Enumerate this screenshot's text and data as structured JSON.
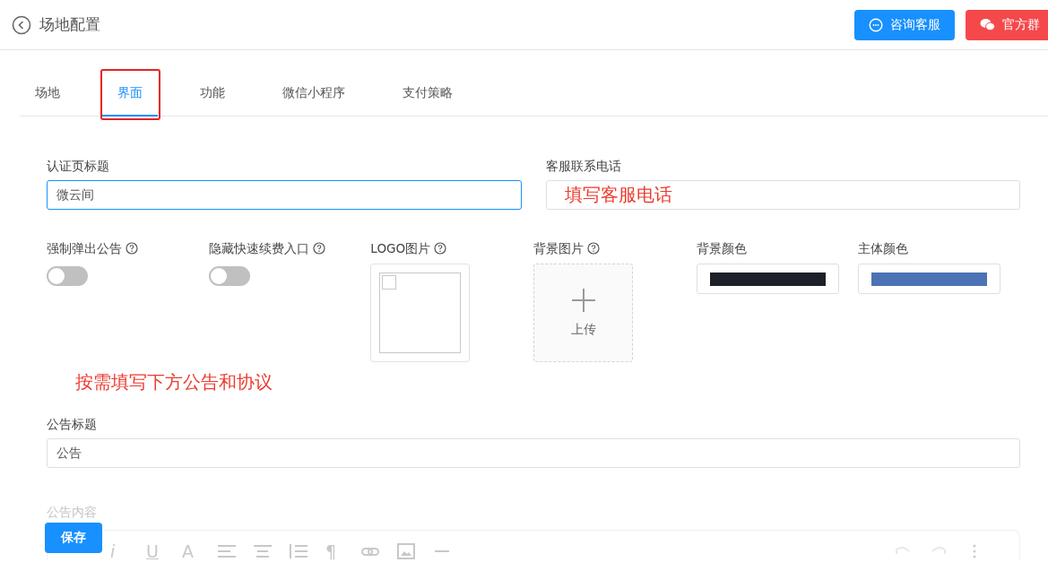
{
  "header": {
    "title": "场地配置",
    "buttons": [
      {
        "label": "咨询客服",
        "kind": "chat"
      },
      {
        "label": "官方群",
        "kind": "wechat"
      }
    ]
  },
  "tabs": [
    {
      "label": "场地",
      "selected": false,
      "highlighted": false
    },
    {
      "label": "界面",
      "selected": true,
      "highlighted": true
    },
    {
      "label": "功能",
      "selected": false,
      "highlighted": false
    },
    {
      "label": "微信小程序",
      "selected": false,
      "highlighted": false
    },
    {
      "label": "支付策略",
      "selected": false,
      "highlighted": false
    }
  ],
  "auth_title": {
    "label": "认证页标题",
    "value": "微云间",
    "focused": true
  },
  "service_phone": {
    "label": "客服联系电话",
    "annotation": "填写客服电话"
  },
  "options": [
    {
      "kind": "switch",
      "label": "强制弹出公告",
      "help": true,
      "on": false
    },
    {
      "kind": "switch",
      "label": "隐藏快速续费入口",
      "help": true,
      "on": false
    },
    {
      "kind": "image",
      "label": "LOGO图片",
      "help": true
    },
    {
      "kind": "upload",
      "label": "背景图片",
      "help": true,
      "upload_label": "上传"
    },
    {
      "kind": "color",
      "label": "背景颜色",
      "help": false,
      "color": "#1d2029"
    },
    {
      "kind": "color",
      "label": "主体颜色",
      "help": false,
      "color": "#4a72b4"
    }
  ],
  "annotation": "按需填写下方公告和协议",
  "notice_title": {
    "label": "公告标题",
    "value": "公告"
  },
  "notice_content": {
    "label": "公告内容",
    "toolbar": [
      {
        "kind": "text",
        "label": "i"
      },
      {
        "kind": "text",
        "label": "U"
      },
      {
        "kind": "text",
        "label": "A"
      },
      {
        "kind": "align-left"
      },
      {
        "kind": "align-center"
      },
      {
        "kind": "list"
      },
      {
        "kind": "text",
        "label": "¶"
      },
      {
        "kind": "link"
      },
      {
        "kind": "image"
      },
      {
        "kind": "rule"
      },
      {
        "kind": "undo"
      },
      {
        "kind": "redo"
      },
      {
        "kind": "more"
      }
    ]
  },
  "save_button": "保存"
}
